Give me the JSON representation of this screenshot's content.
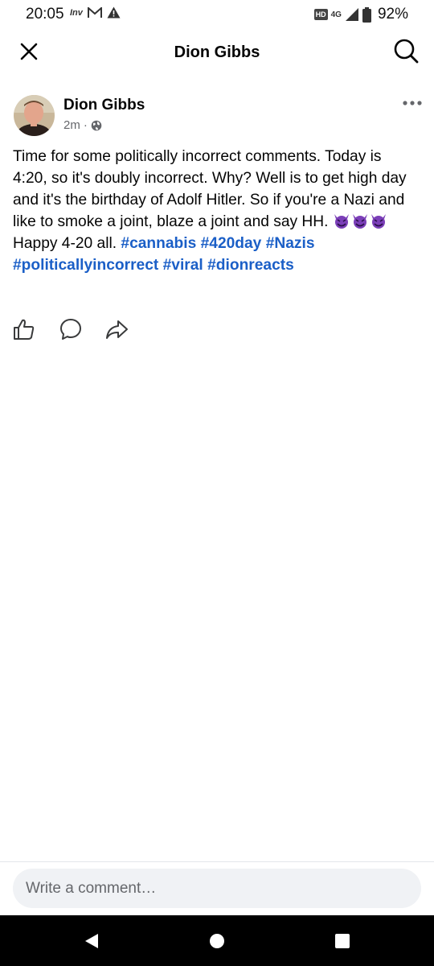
{
  "status_bar": {
    "time": "20:05",
    "left_icons": [
      "inv-icon",
      "gmail-icon",
      "warning-icon"
    ],
    "inv_label": "Inv",
    "hd_label": "HD",
    "network_label": "4G",
    "battery_percent": "92%"
  },
  "header": {
    "title": "Dion Gibbs"
  },
  "post": {
    "author": "Dion Gibbs",
    "time_ago": "2m",
    "separator": "·",
    "body_text": "Time for some politically incorrect comments. Today is 4:20, so it's doubly incorrect. Why? Well is to get high day and it's the birthday of Adolf Hitler. So if you're a Nazi and like to smoke a joint, blaze a joint and say HH.",
    "body_after_emoji": "Happy 4-20 all.",
    "emoji_count": 3,
    "hashtags": [
      "#cannabis",
      "#420day",
      "#Nazis",
      "#politicallyincorrect",
      "#viral",
      "#dionreacts"
    ]
  },
  "comment": {
    "placeholder": "Write a comment…"
  },
  "colors": {
    "hashtag": "#1b5fc7",
    "meta_text": "#65676b",
    "comment_bg": "#f0f2f5",
    "devil_purple": "#7b3fb8"
  }
}
